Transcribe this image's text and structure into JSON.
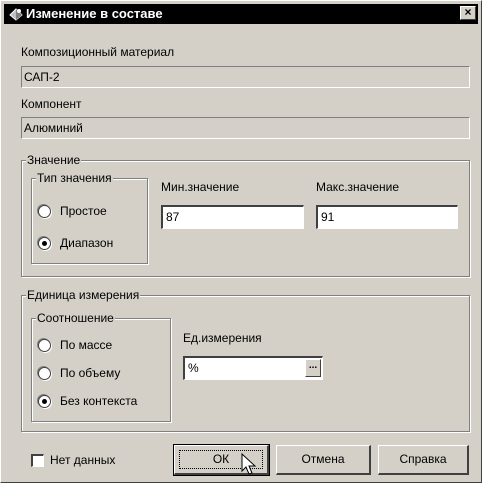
{
  "window": {
    "title": "Изменение в составе",
    "close_glyph": "×"
  },
  "fields": {
    "material_label": "Композиционный материал",
    "material_value": "САП-2",
    "component_label": "Компонент",
    "component_value": "Алюминий"
  },
  "value_group": {
    "legend": "Значение",
    "type_legend": "Тип значения",
    "simple_label": "Простое",
    "range_label": "Диапазон",
    "selected": "range",
    "min_label": "Мин.значение",
    "min_value": "87",
    "max_label": "Макс.значение",
    "max_value": "91"
  },
  "unit_group": {
    "legend": "Единица измерения",
    "ratio_legend": "Соотношение",
    "by_mass": "По массе",
    "by_volume": "По объему",
    "no_context": "Без контекста",
    "selected": "no_context",
    "unit_label": "Ед.измерения",
    "unit_value": "%",
    "browse_glyph": "..."
  },
  "footer": {
    "no_data_label": "Нет данных",
    "no_data_checked": false,
    "ok_label": "ОК",
    "cancel_label": "Отмена",
    "help_label": "Справка"
  }
}
